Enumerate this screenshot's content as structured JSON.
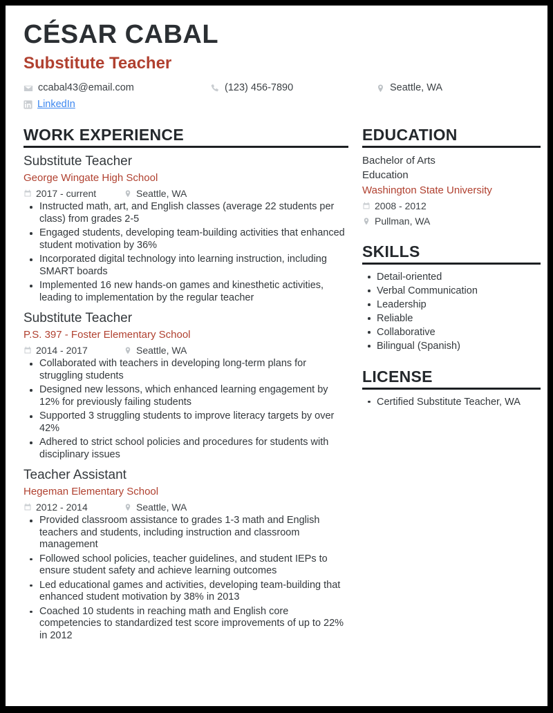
{
  "header": {
    "name": "CÉSAR CABAL",
    "job_title": "Substitute Teacher",
    "accent_color": "#b0402f",
    "contacts": {
      "email": "ccabal43@email.com",
      "phone": "(123) 456-7890",
      "location": "Seattle, WA",
      "linkedin_label": "LinkedIn",
      "linkedin_color": "#3b86f0",
      "email_icon": "envelope-icon",
      "phone_icon": "phone-icon",
      "location_icon": "map-pin-icon",
      "linkedin_icon": "linkedin-icon"
    }
  },
  "work": {
    "heading": "WORK EXPERIENCE",
    "entries": [
      {
        "title": "Substitute Teacher",
        "org": "George Wingate High School",
        "dates": "2017 - current",
        "location": "Seattle, WA",
        "bullets": [
          "Instructed math, art, and English classes (average 22 students per class) from grades 2-5",
          "Engaged students, developing team-building activities that enhanced student motivation by 36%",
          "Incorporated digital technology into learning instruction, including SMART boards",
          "Implemented 16 new hands-on games and kinesthetic activities, leading to implementation by the regular teacher"
        ]
      },
      {
        "title": "Substitute Teacher",
        "org": "P.S. 397 - Foster Elementary School",
        "dates": "2014 - 2017",
        "location": "Seattle, WA",
        "bullets": [
          "Collaborated with teachers in developing long-term plans for struggling students",
          "Designed new lessons, which enhanced learning engagement by 12% for previously failing students",
          "Supported 3 struggling students to improve literacy targets by over 42%",
          "Adhered to strict school policies and procedures for students with disciplinary issues"
        ]
      },
      {
        "title": "Teacher Assistant",
        "org": "Hegeman Elementary School",
        "dates": "2012 - 2014",
        "location": "Seattle, WA",
        "bullets": [
          "Provided classroom assistance to grades 1-3 math and English teachers and students, including instruction and classroom management",
          "Followed school policies, teacher guidelines, and student IEPs to ensure student safety and achieve learning outcomes",
          "Led educational games and activities, developing team-building that enhanced student motivation by 38% in 2013",
          "Coached 10 students in reaching math and English core competencies to standardized test score improvements of up to 22% in 2012"
        ]
      }
    ]
  },
  "education": {
    "heading": "EDUCATION",
    "degree": "Bachelor of Arts",
    "field": "Education",
    "school": "Washington State University",
    "dates": "2008 - 2012",
    "location": "Pullman, WA"
  },
  "skills": {
    "heading": "SKILLS",
    "items": [
      "Detail-oriented",
      "Verbal Communication",
      "Leadership",
      "Reliable",
      "Collaborative",
      "Bilingual (Spanish)"
    ]
  },
  "license": {
    "heading": "LICENSE",
    "items": [
      "Certified Substitute Teacher, WA"
    ]
  }
}
